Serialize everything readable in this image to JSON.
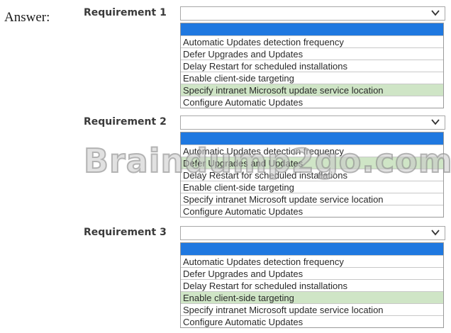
{
  "answer_label": "Answer:",
  "watermark": "Braindump2go.com",
  "colors": {
    "highlight_blue": "#1f78e0",
    "selected_green": "#cfe5c6"
  },
  "requirements": [
    {
      "label": "Requirement 1",
      "selected_index": 4,
      "options": [
        "Automatic Updates detection frequency",
        "Defer Upgrades and Updates",
        "Delay Restart for scheduled installations",
        "Enable client-side targeting",
        "Specify intranet Microsoft update service location",
        "Configure Automatic Updates"
      ]
    },
    {
      "label": "Requirement 2",
      "selected_index": 1,
      "options": [
        "Automatic Updates detection frequency",
        "Defer Upgrades and Updates",
        "Delay Restart for scheduled installations",
        "Enable client-side targeting",
        "Specify intranet Microsoft update service location",
        "Configure Automatic Updates"
      ]
    },
    {
      "label": "Requirement 3",
      "selected_index": 3,
      "options": [
        "Automatic Updates detection frequency",
        "Defer Upgrades and Updates",
        "Delay Restart for scheduled installations",
        "Enable client-side targeting",
        "Specify intranet Microsoft update service location",
        "Configure Automatic Updates"
      ]
    }
  ]
}
